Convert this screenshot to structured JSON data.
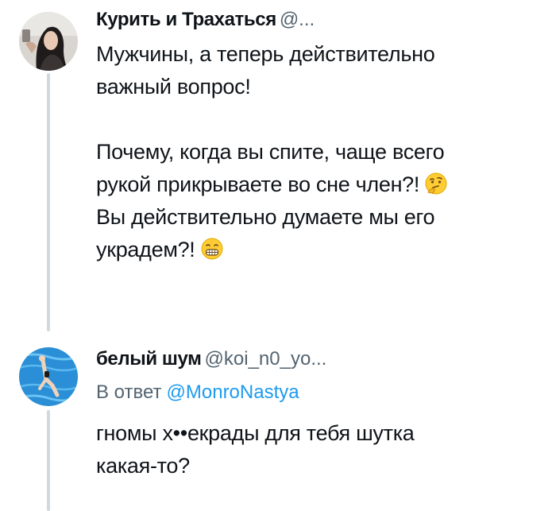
{
  "tweets": [
    {
      "display_name": "Курить и Трахаться",
      "handle": "@...",
      "avatar_icon": "woman-portrait-avatar",
      "paragraphs": [
        [
          "Мужчины, а теперь действительно",
          "важный вопрос!"
        ],
        [
          "Почему, когда вы спите, чаще всего",
          "рукой прикрываете во сне член?!",
          "Вы действительно думаете мы его",
          "украдем?!"
        ]
      ],
      "emojis": [
        "thinking-face-emoji",
        "grinning-face-emoji"
      ]
    },
    {
      "display_name": "белый шум",
      "handle": "@koi_n0_yo...",
      "avatar_icon": "swimmer-pool-avatar",
      "reply_label": "В ответ",
      "reply_handle": "@MonroNastya",
      "lines": [
        "гномы х••екрады для тебя шутка",
        "какая-то?"
      ]
    }
  ],
  "colors": {
    "text": "#0f1419",
    "secondary": "#536471",
    "link": "#1d9bf0",
    "thread_line": "#cfd9de"
  }
}
